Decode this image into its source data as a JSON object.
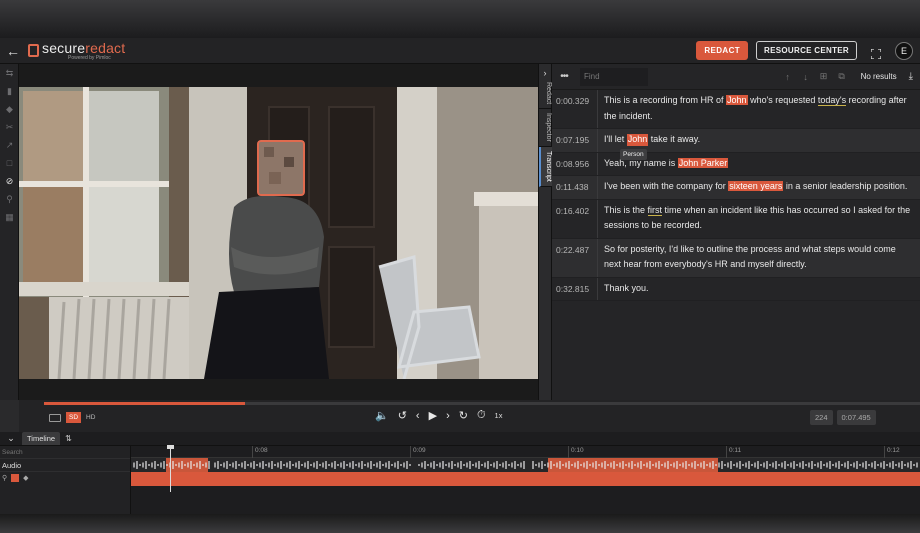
{
  "app": {
    "logo_main": "secure",
    "logo_accent": "redact",
    "logo_sub": "Powered by Pimloc"
  },
  "header": {
    "redact_label": "REDACT",
    "resource_label": "RESOURCE CENTER",
    "avatar_initial": "E"
  },
  "side_tabs": [
    "Redact",
    "Inspector",
    "Transcript"
  ],
  "transcript": {
    "find_placeholder": "Find",
    "no_results": "No results",
    "tooltip": "Person",
    "rows": [
      {
        "ts": "0:00.329"
      },
      {
        "ts": "0:07.195"
      },
      {
        "ts": "0:08.956"
      },
      {
        "ts": "0:11.438"
      },
      {
        "ts": "0:16.402"
      },
      {
        "ts": "0:22.487"
      },
      {
        "ts": "0:32.815"
      }
    ],
    "r0": {
      "a": "This is a recording from HR of ",
      "h1": "John",
      "b": " who's requested ",
      "u1": "today's",
      "c": " recording after the incident."
    },
    "r1": {
      "a": "I'll let ",
      "h1": "John",
      "b": " take it away."
    },
    "r2": {
      "a": "Yeah, my name is ",
      "h1": "John Parker"
    },
    "r3": {
      "a": "I've been with the company for ",
      "h1": "sixteen years",
      "b": " in a senior leadership position."
    },
    "r4": {
      "a": "This is the ",
      "u1": "first",
      "b": " time when an incident like this has occurred so I asked for the sessions to be recorded."
    },
    "r5": {
      "a": "So for posterity, I'd like to outline the process and what steps would come next hear from everybody's HR and myself directly."
    },
    "r6": {
      "a": "Thank you."
    }
  },
  "player": {
    "progress": 0.23,
    "sd_label": "SD",
    "hd_label": "HD",
    "speed_label": "1x",
    "frame_counter": "224",
    "time_counter": "0:07.495"
  },
  "timeline": {
    "tab_label": "Timeline",
    "search_placeholder": "Search",
    "audio_label": "Audio",
    "ticks": [
      "0:08",
      "0:09",
      "0:10",
      "0:11",
      "0:12"
    ]
  },
  "colors": {
    "accent": "#d9583c",
    "background": "#252527"
  }
}
